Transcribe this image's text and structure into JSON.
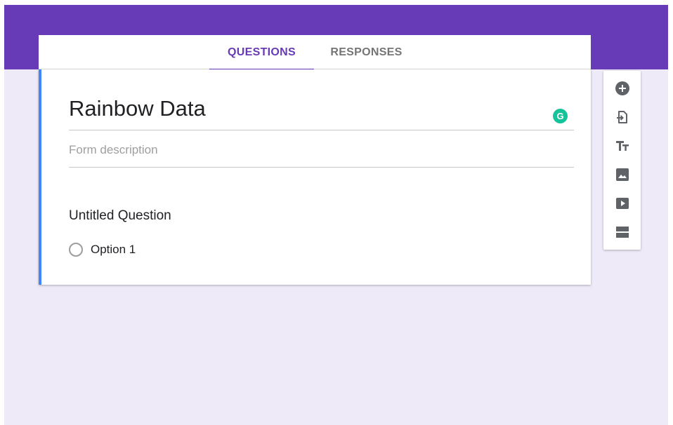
{
  "tabs": [
    {
      "label": "QUESTIONS",
      "active": true
    },
    {
      "label": "RESPONSES",
      "active": false
    }
  ],
  "form": {
    "title": "Rainbow Data",
    "description_placeholder": "Form description",
    "question": {
      "title": "Untitled Question",
      "options": [
        "Option 1"
      ]
    }
  },
  "toolbar": {
    "icons": [
      "add-question-icon",
      "import-questions-icon",
      "add-title-icon",
      "add-image-icon",
      "add-video-icon",
      "add-section-icon"
    ]
  },
  "extension": {
    "grammarly_glyph": "G"
  },
  "colors": {
    "accent": "#673ab7",
    "background": "#eeeaf8",
    "card_accent": "#4285f4",
    "grammarly": "#15c39a",
    "icon": "#5f6368"
  }
}
